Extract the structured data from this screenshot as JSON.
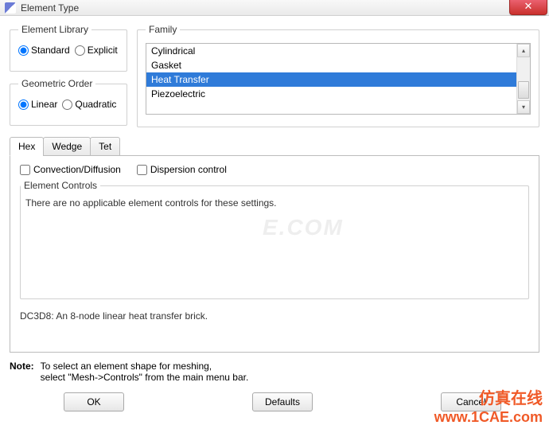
{
  "titlebar": {
    "title": "Element Type",
    "close_glyph": "✕"
  },
  "element_library": {
    "legend": "Element Library",
    "standard": "Standard",
    "explicit": "Explicit",
    "selected": "standard"
  },
  "geometric_order": {
    "legend": "Geometric Order",
    "linear": "Linear",
    "quadratic": "Quadratic",
    "selected": "linear"
  },
  "family": {
    "legend": "Family",
    "items": [
      "Cylindrical",
      "Gasket",
      "Heat Transfer",
      "Piezoelectric"
    ],
    "selected_index": 2,
    "scroll": {
      "up": "▴",
      "down": "▾"
    }
  },
  "tabs": {
    "items": [
      "Hex",
      "Wedge",
      "Tet"
    ],
    "active": 0
  },
  "checks": {
    "convection": "Convection/Diffusion",
    "dispersion": "Dispersion control"
  },
  "controls_box": {
    "legend": "Element Controls",
    "message": "There are no applicable element controls for these settings."
  },
  "element_desc": "DC3D8:  An 8-node linear heat transfer brick.",
  "note": {
    "label": "Note:",
    "line1": "To select an element shape for meshing,",
    "line2": "select \"Mesh->Controls\" from the main menu bar."
  },
  "buttons": {
    "ok": "OK",
    "defaults": "Defaults",
    "cancel": "Cancel"
  },
  "watermark": {
    "cn": "仿真在线",
    "url": "www.1CAE.com",
    "mid": "E.COM"
  }
}
